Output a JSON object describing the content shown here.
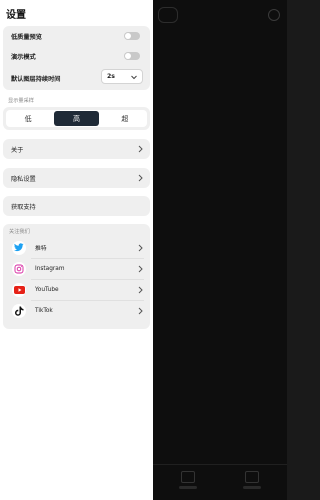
{
  "title": "设置",
  "settings": {
    "low_quality_preview": "低质量预览",
    "demo_mode": "演示模式",
    "default_layer_duration": "默认图层持续时间",
    "duration_value": "2s"
  },
  "sampling": {
    "label": "显示量采样",
    "options": [
      "低",
      "高",
      "超"
    ],
    "selected": "高"
  },
  "links": {
    "about": "关于",
    "privacy": "隐私设置",
    "support": "获取支持"
  },
  "follow": {
    "label": "关注我们",
    "items": [
      {
        "label": "推特",
        "icon": "twitter-icon"
      },
      {
        "label": "Instagram",
        "icon": "instagram-icon"
      },
      {
        "label": "YouTube",
        "icon": "youtube-icon"
      },
      {
        "label": "TikTok",
        "icon": "tiktok-icon"
      }
    ]
  },
  "colors": {
    "accent_dark": "#1f2a37",
    "card_bg": "#efefef",
    "twitter": "#1da1f2",
    "youtube": "#e62117"
  }
}
